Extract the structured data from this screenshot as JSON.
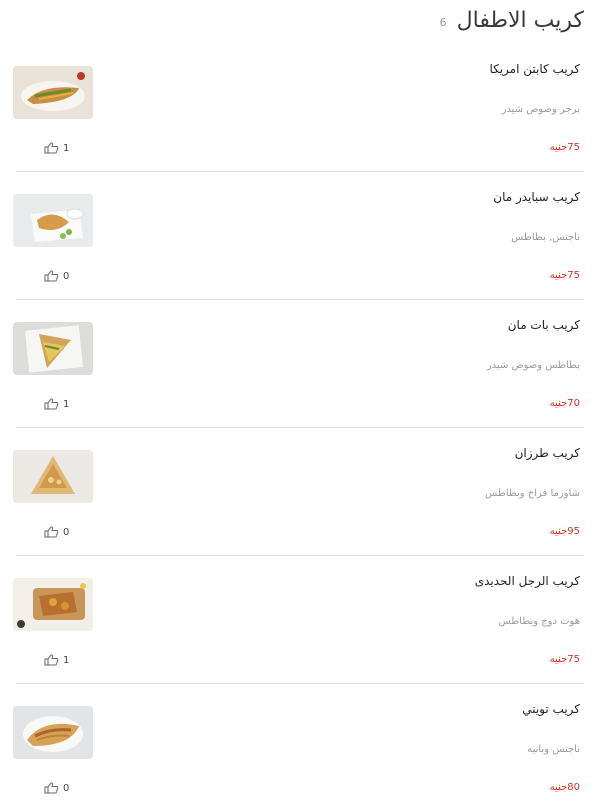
{
  "header": {
    "title": "كريب الاطفال",
    "count": "6"
  },
  "accent_color": "#d0341a",
  "items": [
    {
      "name": "كريب كابتن امريكا",
      "description": "برجر وصوص شيدر",
      "price": "75جنيه",
      "likes": "1",
      "image": "crepe-plate-photo"
    },
    {
      "name": "كريب سبايدر مان",
      "description": "ناجتس, بطاطس",
      "price": "75جنيه",
      "likes": "0",
      "image": "crepe-with-sauce-photo"
    },
    {
      "name": "كريب بات مان",
      "description": "بطاطس وصوص شيدر",
      "price": "70جنيه",
      "likes": "1",
      "image": "folded-crepe-photo"
    },
    {
      "name": "كريب طرزان",
      "description": "شاورما فراخ وبطاطس",
      "price": "95جنيه",
      "likes": "0",
      "image": "folded-crepe-photo"
    },
    {
      "name": "كريب الرجل الحديدى",
      "description": "هوت دوج وبطاطس",
      "price": "75جنيه",
      "likes": "1",
      "image": "crepe-board-photo"
    },
    {
      "name": "كريب تويتي",
      "description": "ناجتس وبانيه",
      "price": "80جنيه",
      "likes": "0",
      "image": "crepe-plate-photo"
    }
  ]
}
